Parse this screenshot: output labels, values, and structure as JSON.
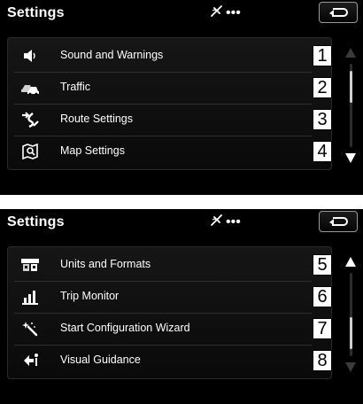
{
  "colors": {
    "screen_background": "#000000",
    "text": "#ffffff",
    "number_box_background": "#ffffff",
    "number_box_text": "#000000",
    "scroll_arrow_active": "#ffffff",
    "scroll_arrow_inactive": "#3a3a3a"
  },
  "screens": [
    {
      "title": "Settings",
      "status_icon": "signal-icon",
      "status_glyph": "⚡",
      "status_dots": "•••",
      "back_button_icon": "return-arrow-icon",
      "scroll_up_enabled": false,
      "scroll_down_enabled": true,
      "scroll_position": 0.1,
      "items": [
        {
          "label": "Sound and Warnings",
          "number": "1",
          "icon": "speaker-icon"
        },
        {
          "label": "Traffic",
          "number": "2",
          "icon": "traffic-icon"
        },
        {
          "label": "Route Settings",
          "number": "3",
          "icon": "route-icon"
        },
        {
          "label": "Map Settings",
          "number": "4",
          "icon": "map-icon"
        }
      ]
    },
    {
      "title": "Settings",
      "status_icon": "signal-icon",
      "status_glyph": "⚡",
      "status_dots": "•••",
      "back_button_icon": "return-arrow-icon",
      "scroll_up_enabled": true,
      "scroll_down_enabled": false,
      "scroll_position": 0.9,
      "items": [
        {
          "label": "Units and Formats",
          "number": "5",
          "icon": "units-icon"
        },
        {
          "label": "Trip Monitor",
          "number": "6",
          "icon": "bar-chart-icon"
        },
        {
          "label": "Start Configuration Wizard",
          "number": "7",
          "icon": "wizard-wand-icon"
        },
        {
          "label": "Visual Guidance",
          "number": "8",
          "icon": "guidance-icon"
        }
      ]
    }
  ]
}
